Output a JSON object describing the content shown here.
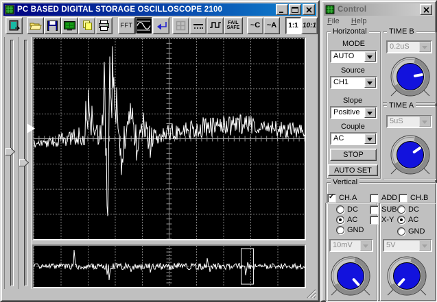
{
  "main_window": {
    "title": "PC BASED DIGITAL STORAGE OSCILLOSCOPE 2100",
    "toolbar": {
      "fft": "FFT",
      "fail_line1": "FAIL",
      "fail_line2": "SAFE",
      "coupling_c": "~C",
      "coupling_a": "~A",
      "probe_1_1": "1:1",
      "probe_10_1": "10:1"
    }
  },
  "control_window": {
    "title": "Control",
    "menu": {
      "file": "File",
      "help": "Help"
    },
    "horizontal": {
      "label": "Horizontal",
      "mode_label": "MODE",
      "mode_value": "AUTO",
      "source_label": "Source",
      "source_value": "CH1",
      "slope_label": "Slope",
      "slope_value": "Positive",
      "couple_label": "Couple",
      "couple_value": "AC",
      "stop": "STOP",
      "auto_set": "AUTO SET"
    },
    "time_b": {
      "label": "TIME B",
      "value": "0.2uS",
      "knob_angle": 10
    },
    "time_a": {
      "label": "TIME A",
      "value": "5uS",
      "knob_angle": 35
    },
    "vertical": {
      "label": "Vertical",
      "ch_a": {
        "label": "CH.A",
        "checked": true,
        "radios": [
          {
            "label": "DC",
            "checked": false
          },
          {
            "label": "AC",
            "checked": true
          },
          {
            "label": "GND",
            "checked": false
          }
        ],
        "volt_div": "10mV",
        "knob_angle": -48
      },
      "add": {
        "label": "ADD",
        "checked": false
      },
      "sub": {
        "label": "SUB",
        "checked": false
      },
      "xy": {
        "label": "X-Y",
        "checked": false
      },
      "ch_b": {
        "label": "CH.B",
        "checked": false,
        "radios": [
          {
            "label": "DC",
            "checked": false
          },
          {
            "label": "AC",
            "checked": true
          },
          {
            "label": "GND",
            "checked": false
          }
        ],
        "volt_div": "5V",
        "knob_angle": 228
      }
    }
  },
  "scope": {
    "bg": "#000000",
    "grid_color": "#7d7d7d",
    "axis_color": "#9a9a9a",
    "trace_color": "#ffffff",
    "trigger_y_frac": 0.455,
    "main_waveform": {
      "seed": 7,
      "keyframes": [
        {
          "x": 0.0,
          "mean": 8,
          "amp": 5
        },
        {
          "x": 0.05,
          "mean": 6,
          "amp": 7
        },
        {
          "x": 0.1,
          "mean": 2,
          "amp": 10
        },
        {
          "x": 0.15,
          "mean": -2,
          "amp": 13
        },
        {
          "x": 0.19,
          "mean": -8,
          "amp": 18
        },
        {
          "x": 0.23,
          "mean": -6,
          "amp": 14
        },
        {
          "x": 0.27,
          "mean": 0,
          "amp": 20
        },
        {
          "x": 0.31,
          "mean": -10,
          "amp": 25
        },
        {
          "x": 0.34,
          "mean": -5,
          "amp": 18
        },
        {
          "x": 0.37,
          "mean": -20,
          "amp": 14
        },
        {
          "x": 0.4,
          "mean": -8,
          "amp": 12
        },
        {
          "x": 0.43,
          "mean": -16,
          "amp": 12
        },
        {
          "x": 0.46,
          "mean": -4,
          "amp": 12
        },
        {
          "x": 0.5,
          "mean": -10,
          "amp": 13
        },
        {
          "x": 0.55,
          "mean": -13,
          "amp": 14
        },
        {
          "x": 0.62,
          "mean": -16,
          "amp": 15
        },
        {
          "x": 0.7,
          "mean": -19,
          "amp": 15
        },
        {
          "x": 0.78,
          "mean": -21,
          "amp": 15
        },
        {
          "x": 0.86,
          "mean": -17,
          "amp": 13
        },
        {
          "x": 0.93,
          "mean": -13,
          "amp": 12
        },
        {
          "x": 1.0,
          "mean": -11,
          "amp": 11
        }
      ],
      "spikes": [
        [
          0.192,
          -55
        ],
        [
          0.197,
          -25
        ],
        [
          0.202,
          -72
        ],
        [
          0.208,
          -30
        ],
        [
          0.214,
          -48
        ],
        [
          0.22,
          -18
        ],
        [
          0.253,
          -35
        ],
        [
          0.258,
          -60
        ],
        [
          0.262,
          -112
        ],
        [
          0.266,
          25
        ],
        [
          0.27,
          98
        ],
        [
          0.274,
          113
        ],
        [
          0.278,
          -40
        ],
        [
          0.282,
          -120
        ],
        [
          0.287,
          -55
        ],
        [
          0.292,
          -135
        ],
        [
          0.297,
          -90
        ],
        [
          0.302,
          -40
        ],
        [
          0.307,
          -75
        ],
        [
          0.312,
          -15
        ],
        [
          0.318,
          25
        ],
        [
          0.324,
          53
        ],
        [
          0.33,
          35
        ],
        [
          0.336,
          15
        ],
        [
          0.352,
          -40
        ],
        [
          0.358,
          -52
        ],
        [
          0.365,
          -45
        ],
        [
          0.372,
          10
        ],
        [
          0.379,
          32
        ],
        [
          0.386,
          18
        ],
        [
          0.398,
          -22
        ],
        [
          0.406,
          -38
        ],
        [
          0.414,
          -25
        ],
        [
          0.422,
          15
        ],
        [
          0.43,
          28
        ],
        [
          0.438,
          12
        ]
      ]
    },
    "preview_waveform": {
      "seed": 13,
      "keyframes": [
        {
          "x": 0.0,
          "mean": 0,
          "amp": 4
        },
        {
          "x": 0.5,
          "mean": 0,
          "amp": 5
        },
        {
          "x": 1.0,
          "mean": 0,
          "amp": 4
        }
      ],
      "spikes": [
        [
          0.149,
          -24
        ],
        [
          0.27,
          12
        ],
        [
          0.278,
          20
        ],
        [
          0.36,
          8
        ],
        [
          0.43,
          9
        ],
        [
          0.64,
          -12
        ],
        [
          0.65,
          8
        ],
        [
          0.782,
          13
        ],
        [
          0.79,
          -6
        ]
      ],
      "zoom_box": {
        "x_frac": 0.766,
        "w_frac": 0.045
      }
    }
  },
  "sliders": {
    "left_thumb_frac": 0.455,
    "right_thumb_frac": 0.5
  }
}
